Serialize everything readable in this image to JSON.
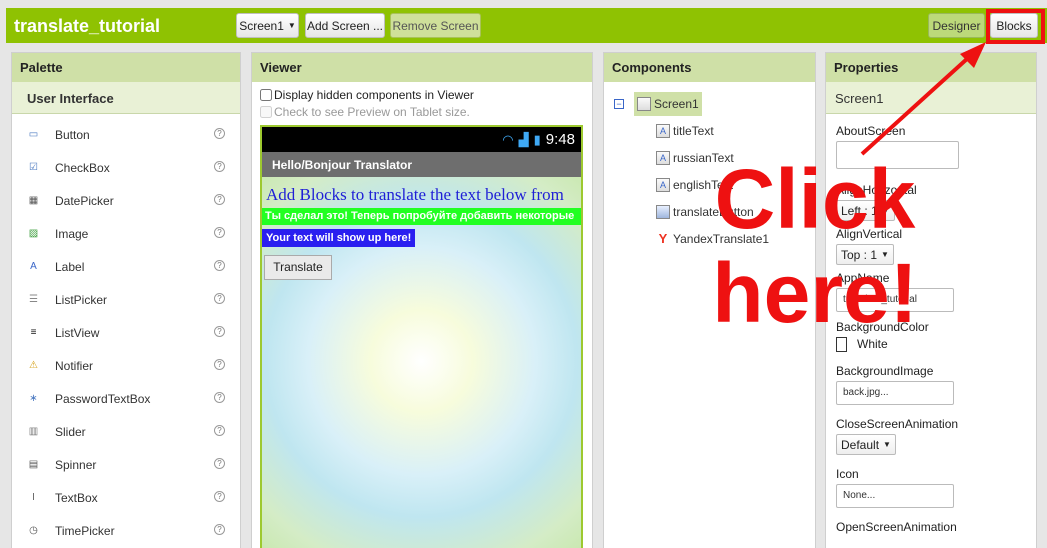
{
  "app": {
    "project_name": "translate_tutorial"
  },
  "toolbar": {
    "screen_selector": "Screen1",
    "add_screen": "Add Screen ...",
    "remove_screen": "Remove Screen",
    "designer": "Designer",
    "blocks": "Blocks"
  },
  "palette": {
    "title": "Palette",
    "category": "User Interface",
    "items": [
      {
        "label": "Button",
        "icon": "button-icon"
      },
      {
        "label": "CheckBox",
        "icon": "checkbox-icon"
      },
      {
        "label": "DatePicker",
        "icon": "datepicker-icon"
      },
      {
        "label": "Image",
        "icon": "image-icon"
      },
      {
        "label": "Label",
        "icon": "label-icon"
      },
      {
        "label": "ListPicker",
        "icon": "listpicker-icon"
      },
      {
        "label": "ListView",
        "icon": "listview-icon"
      },
      {
        "label": "Notifier",
        "icon": "notifier-icon"
      },
      {
        "label": "PasswordTextBox",
        "icon": "password-icon"
      },
      {
        "label": "Slider",
        "icon": "slider-icon"
      },
      {
        "label": "Spinner",
        "icon": "spinner-icon"
      },
      {
        "label": "TextBox",
        "icon": "textbox-icon"
      },
      {
        "label": "TimePicker",
        "icon": "timepicker-icon"
      }
    ],
    "help_glyph": "?"
  },
  "viewer": {
    "title": "Viewer",
    "display_hidden": "Display hidden components in Viewer",
    "tablet_preview": "Check to see Preview on Tablet size.",
    "status_time": "9:48",
    "screen_title": "Hello/Bonjour Translator",
    "heading_text": "Add Blocks to translate the text below from",
    "russian_text": "Ты сделал это! Теперь попробуйте добавить некоторые",
    "output_text": "Your text will show up here!",
    "button_text": "Translate"
  },
  "components": {
    "title": "Components",
    "root": "Screen1",
    "children": [
      {
        "label": "titleText",
        "icon": "label-icon"
      },
      {
        "label": "russianText",
        "icon": "label-icon"
      },
      {
        "label": "englishText",
        "icon": "label-icon"
      },
      {
        "label": "translateButton",
        "icon": "button-icon"
      },
      {
        "label": "YandexTranslate1",
        "icon": "yandex-icon"
      }
    ]
  },
  "properties": {
    "title": "Properties",
    "component": "Screen1",
    "about_label": "AboutScreen",
    "about_value": "",
    "align_h_label": "AlignHorizontal",
    "align_h_value": "Left : 1",
    "align_v_label": "AlignVertical",
    "align_v_value": "Top : 1",
    "appname_label": "AppName",
    "appname_value": "translate_tutorial",
    "bgcolor_label": "BackgroundColor",
    "bgcolor_value": "White",
    "bgimage_label": "BackgroundImage",
    "bgimage_value": "back.jpg...",
    "close_anim_label": "CloseScreenAnimation",
    "close_anim_value": "Default",
    "icon_label": "Icon",
    "icon_value": "None...",
    "open_anim_label": "OpenScreenAnimation"
  },
  "annotation": {
    "line1": "Click",
    "line2": "here!",
    "color": "#ee1111"
  },
  "colors": {
    "accent": "#8fc202",
    "panel_header": "#cfe0a7"
  }
}
